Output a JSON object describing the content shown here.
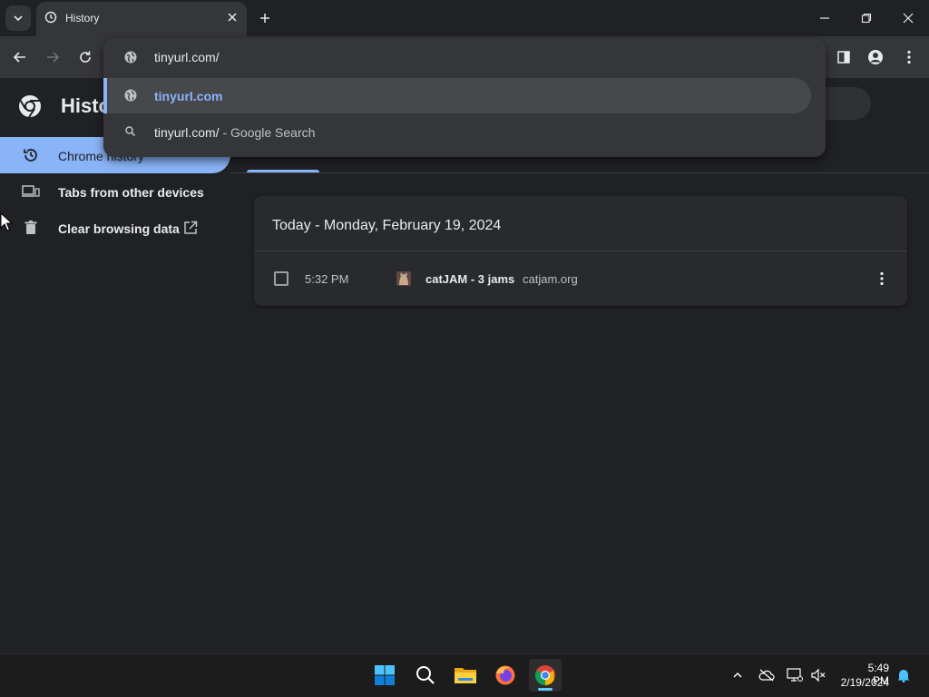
{
  "browser": {
    "tab": {
      "title": "History"
    },
    "omnibox": {
      "value": "tinyurl.com/",
      "suggestions": [
        {
          "text": "tinyurl.com",
          "suffix": ""
        },
        {
          "text": "tinyurl.com/",
          "suffix": " - Google Search"
        }
      ]
    }
  },
  "page": {
    "title": "History",
    "sidebar": {
      "items": [
        {
          "label": "Chrome history"
        },
        {
          "label": "Tabs from other devices"
        },
        {
          "label": "Clear browsing data"
        }
      ]
    },
    "history": {
      "date_header": "Today - Monday, February 19, 2024",
      "entries": [
        {
          "time": "5:32 PM",
          "title": "catJAM - 3 jams",
          "domain": "catjam.org"
        }
      ]
    }
  },
  "taskbar": {
    "time": "5:49 PM",
    "date": "2/19/2024"
  },
  "colors": {
    "accent": "#8ab4f8",
    "background": "#202124",
    "toolbar": "#35363a"
  }
}
